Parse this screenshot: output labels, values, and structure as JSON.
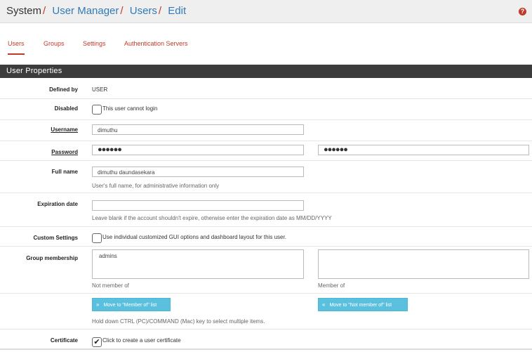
{
  "breadcrumb": {
    "items": [
      "System",
      "User Manager",
      "Users",
      "Edit"
    ],
    "separator": "/"
  },
  "help_icon": "?",
  "tabs": [
    "Users",
    "Groups",
    "Settings",
    "Authentication Servers"
  ],
  "panel": {
    "title": "User Properties"
  },
  "form": {
    "defined_by": {
      "label": "Defined by",
      "value": "USER"
    },
    "disabled": {
      "label": "Disabled",
      "checkbox_label": "This user cannot login",
      "checked": false
    },
    "username": {
      "label": "Username",
      "value": "dimuthu"
    },
    "password": {
      "label": "Password",
      "value": "●●●●●●",
      "confirm_value": "●●●●●●"
    },
    "full_name": {
      "label": "Full name",
      "value": "dimuthu daundasekara",
      "hint": "User's full name, for administrative information only"
    },
    "expiration": {
      "label": "Expiration date",
      "value": "",
      "hint": "Leave blank if the account shouldn't expire, otherwise enter the expiration date as MM/DD/YYYY"
    },
    "custom_settings": {
      "label": "Custom Settings",
      "checkbox_label": "Use individual customized GUI options and dashboard layout for this user.",
      "checked": false
    },
    "group_membership": {
      "label": "Group membership",
      "not_member_of": [
        "admins"
      ],
      "member_of": [],
      "not_member_caption": "Not member of",
      "member_caption": "Member of",
      "move_to_member_button": "Move to \"Member of\" list",
      "move_to_not_member_button": "Move to \"Not member of\" list",
      "move_to_member_icon": "»",
      "move_to_not_member_icon": "«",
      "hint": "Hold down CTRL (PC)/COMMAND (Mac) key to select multiple items."
    },
    "certificate": {
      "label": "Certificate",
      "checkbox_label": "Click to create a user certificate",
      "checked": true,
      "check_mark": "✔"
    }
  },
  "colors": {
    "accent": "#c0392b",
    "link": "#337ab7",
    "panel_header": "#3c3c3c",
    "info_button": "#5bc0de"
  }
}
